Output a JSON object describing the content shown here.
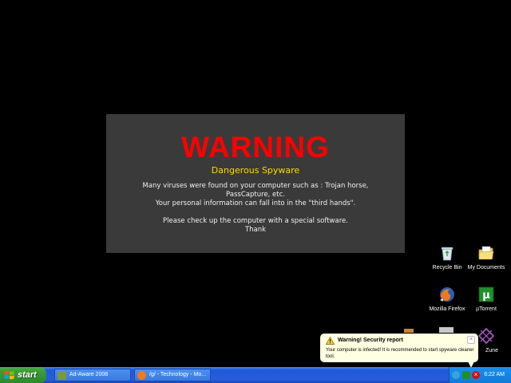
{
  "warning": {
    "title": "WARNING",
    "subtitle": "Dangerous Spyware",
    "line1": "Many viruses were found on your computer such as : Trojan horse,",
    "line2": "PassCapture, etc.",
    "line3": "Your personal information can fall into in the \"third hands\".",
    "line4": "Please check up the computer with a special software.",
    "line5": "Thank",
    "title_color": "#ff0000",
    "subtitle_color": "#ffd700"
  },
  "desktop_icons": {
    "recycle_bin": "Recycle Bin",
    "my_documents": "My Documents",
    "firefox": "Mozilla Firefox",
    "utorrent": "µTorrent",
    "zune": "Zune"
  },
  "balloon": {
    "title": "Warning! Security report",
    "text": "Your computer is infected! It is recommended to start spyware cleaner tool.",
    "close": "×"
  },
  "taskbar": {
    "start_label": "start",
    "task1": "Ad-Aware 2008",
    "task2": "/g/ - Technology - Mo...",
    "clock": "6:22 AM",
    "color": "#245ddb"
  }
}
